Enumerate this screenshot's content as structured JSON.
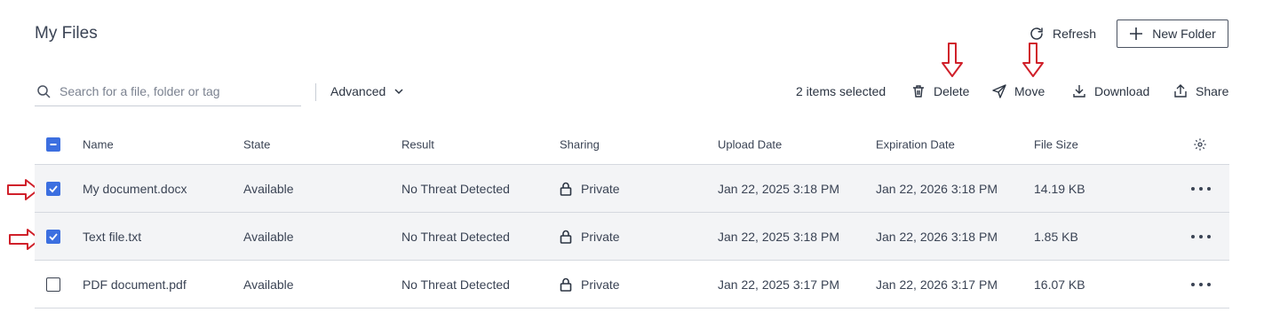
{
  "page": {
    "title": "My Files"
  },
  "header": {
    "refresh_label": "Refresh",
    "new_folder_label": "New Folder"
  },
  "toolbar": {
    "search_placeholder": "Search for a file, folder or tag",
    "advanced_label": "Advanced",
    "selected_count": "2 items selected",
    "delete_label": "Delete",
    "move_label": "Move",
    "download_label": "Download",
    "share_label": "Share"
  },
  "table": {
    "columns": [
      "Name",
      "State",
      "Result",
      "Sharing",
      "Upload Date",
      "Expiration Date",
      "File Size"
    ],
    "rows": [
      {
        "checked": true,
        "name": "My document.docx",
        "state": "Available",
        "result": "No Threat Detected",
        "sharing": "Private",
        "upload": "Jan 22, 2025 3:18 PM",
        "expiration": "Jan 22, 2026 3:18 PM",
        "size": "14.19 KB"
      },
      {
        "checked": true,
        "name": "Text file.txt",
        "state": "Available",
        "result": "No Threat Detected",
        "sharing": "Private",
        "upload": "Jan 22, 2025 3:18 PM",
        "expiration": "Jan 22, 2026 3:18 PM",
        "size": "1.85 KB"
      },
      {
        "checked": false,
        "name": "PDF document.pdf",
        "state": "Available",
        "result": "No Threat Detected",
        "sharing": "Private",
        "upload": "Jan 22, 2025 3:17 PM",
        "expiration": "Jan 22, 2026 3:17 PM",
        "size": "16.07 KB"
      }
    ]
  },
  "colors": {
    "accent": "#3c6fe0",
    "annotation_arrow": "#d0202a"
  }
}
